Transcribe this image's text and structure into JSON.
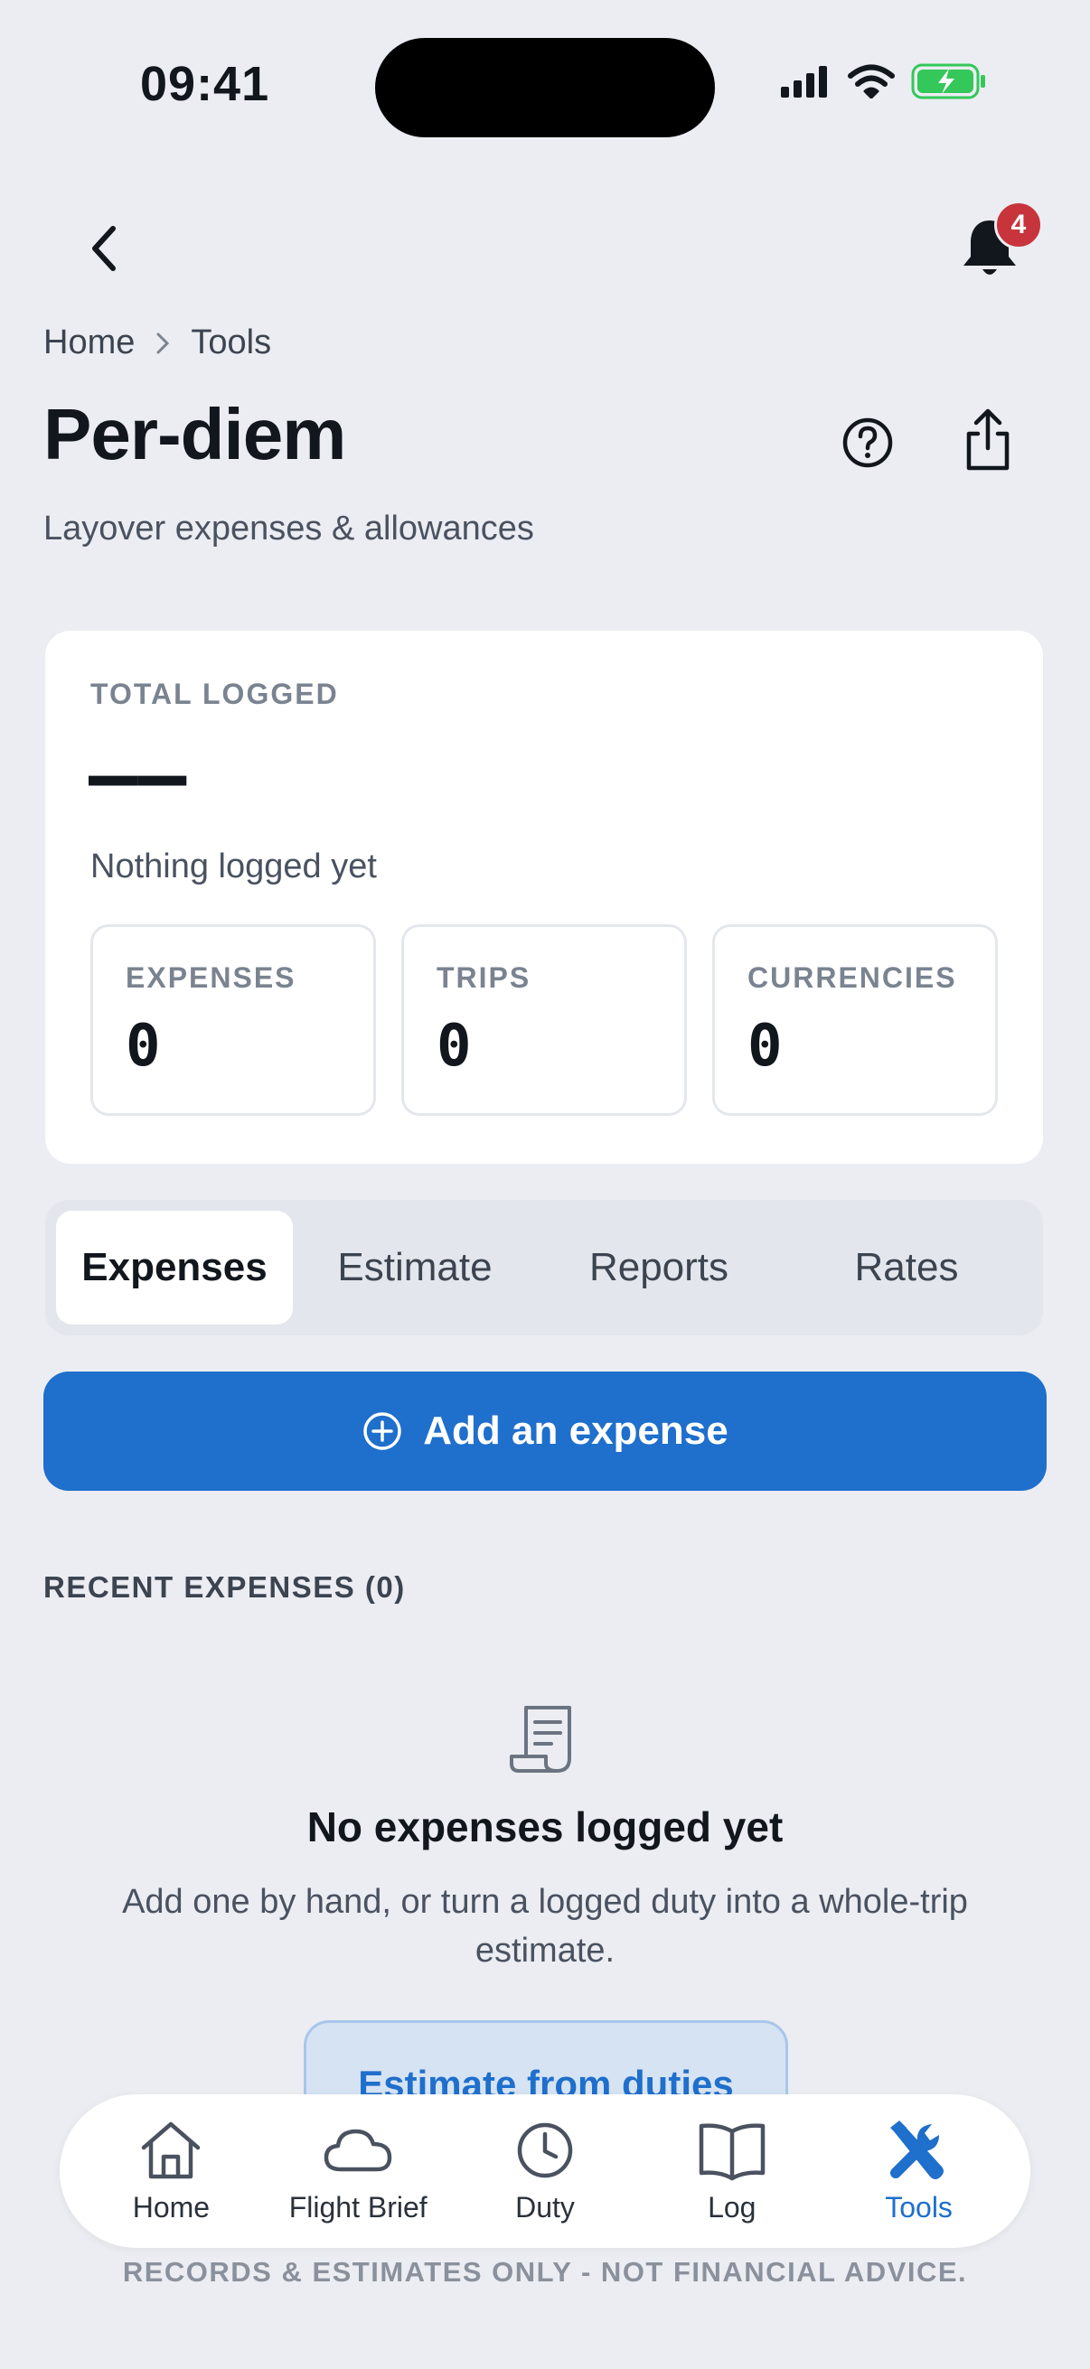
{
  "status_bar": {
    "time": "09:41"
  },
  "header": {
    "notifications_count": "4"
  },
  "breadcrumb": {
    "home": "Home",
    "tools": "Tools"
  },
  "page": {
    "title": "Per-diem",
    "subtitle": "Layover expenses & allowances"
  },
  "summary": {
    "label": "TOTAL LOGGED",
    "value": "——",
    "note": "Nothing logged yet",
    "stats": [
      {
        "label": "EXPENSES",
        "value": "0"
      },
      {
        "label": "TRIPS",
        "value": "0"
      },
      {
        "label": "CURRENCIES",
        "value": "0"
      }
    ]
  },
  "tabs": [
    {
      "label": "Expenses",
      "active": true
    },
    {
      "label": "Estimate"
    },
    {
      "label": "Reports"
    },
    {
      "label": "Rates"
    }
  ],
  "actions": {
    "add_expense": "Add an expense",
    "estimate_from_duties": "Estimate from duties"
  },
  "recent": {
    "label": "RECENT EXPENSES (0)"
  },
  "empty_state": {
    "title": "No expenses logged yet",
    "text": "Add one by hand, or turn a logged duty into a whole-trip estimate."
  },
  "nav": [
    {
      "label": "Home",
      "icon": "home-icon"
    },
    {
      "label": "Flight Brief",
      "icon": "cloud-icon"
    },
    {
      "label": "Duty",
      "icon": "clock-icon"
    },
    {
      "label": "Log",
      "icon": "book-icon"
    },
    {
      "label": "Tools",
      "icon": "tools-icon",
      "active": true
    }
  ],
  "disclaimer": "RECORDS & ESTIMATES ONLY - NOT FINANCIAL ADVICE.",
  "colors": {
    "accent": "#1f6fcc",
    "badge": "#c8343b",
    "background": "#ebedf2",
    "battery": "#34c759"
  }
}
